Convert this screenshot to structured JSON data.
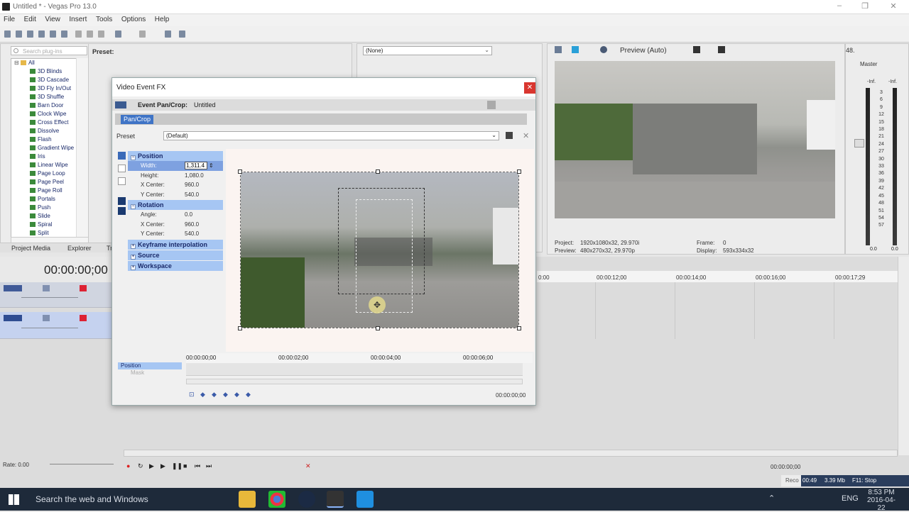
{
  "window": {
    "title": "Untitled * - Vegas Pro 13.0"
  },
  "menu": [
    "File",
    "Edit",
    "View",
    "Insert",
    "Tools",
    "Options",
    "Help"
  ],
  "explorer": {
    "search_placeholder": "Search plug-ins",
    "preset_label": "Preset:",
    "root": "All",
    "items": [
      "3D Blinds",
      "3D Cascade",
      "3D Fly In/Out",
      "3D Shuffle",
      "Barn Door",
      "Clock Wipe",
      "Cross Effect",
      "Dissolve",
      "Flash",
      "Gradient Wipe",
      "Iris",
      "Linear Wipe",
      "Page Loop",
      "Page Peel",
      "Page Roll",
      "Portals",
      "Push",
      "Slide",
      "Spiral",
      "Split"
    ],
    "tabs": [
      "Project Media",
      "Explorer",
      "Tr"
    ]
  },
  "fx_chain": {
    "selected": "(None)"
  },
  "preview": {
    "mode": "Preview (Auto)",
    "project_label": "Project:",
    "project_value": "1920x1080x32, 29.970i",
    "preview_label": "Preview:",
    "preview_value": "480x270x32, 29.970p",
    "frame_label": "Frame:",
    "frame_value": "0",
    "display_label": "Display:",
    "display_value": "593x334x32",
    "zoom": "48."
  },
  "master": {
    "label": "Master",
    "inf_left": "-Inf.",
    "inf_right": "-Inf.",
    "scale": [
      "3",
      "6",
      "9",
      "12",
      "15",
      "18",
      "21",
      "24",
      "27",
      "30",
      "33",
      "36",
      "39",
      "42",
      "45",
      "48",
      "51",
      "54",
      "57"
    ],
    "level_left": "0.0",
    "level_right": "0.0"
  },
  "timeline": {
    "timecode": "00:00:00;00",
    "ruler": [
      "0:00",
      "00:00:12;00",
      "00:00:14;00",
      "00:00:16;00",
      "00:00:17;29"
    ],
    "rate": "Rate: 0.00",
    "end_time": "00:00:00;00",
    "record_label": "Reco"
  },
  "dialog": {
    "title": "Video Event FX",
    "header_label": "Event Pan/Crop:",
    "header_value": "Untitled",
    "tab": "Pan/Crop",
    "preset_label": "Preset",
    "preset_value": "(Default)",
    "position_header": "Position",
    "width_label": "Width:",
    "width_value": "1,311.4",
    "height_label": "Height:",
    "height_value": "1,080.0",
    "xcenter_label": "X Center:",
    "xcenter_value": "960.0",
    "ycenter_label": "Y Center:",
    "ycenter_value": "540.0",
    "rotation_header": "Rotation",
    "angle_label": "Angle:",
    "angle_value": "0.0",
    "rxcenter_label": "X Center:",
    "rxcenter_value": "960.0",
    "rycenter_label": "Y Center:",
    "rycenter_value": "540.0",
    "keyframe_header": "Keyframe interpolation",
    "source_header": "Source",
    "workspace_header": "Workspace",
    "kf_ruler": [
      "00:00:00;00",
      "00:00:02;00",
      "00:00:04;00",
      "00:00:06;00"
    ],
    "kf_track_position": "Position",
    "kf_track_mask": "Mask",
    "kf_time": "00:00:00;00"
  },
  "statusbar": {
    "time": "00:49",
    "size": "3.39 Mb",
    "hint": "F11: Stop"
  },
  "taskbar": {
    "search": "Search the web and Windows",
    "lang": "ENG",
    "clock": "8:53 PM",
    "date": "2016-04-22"
  }
}
